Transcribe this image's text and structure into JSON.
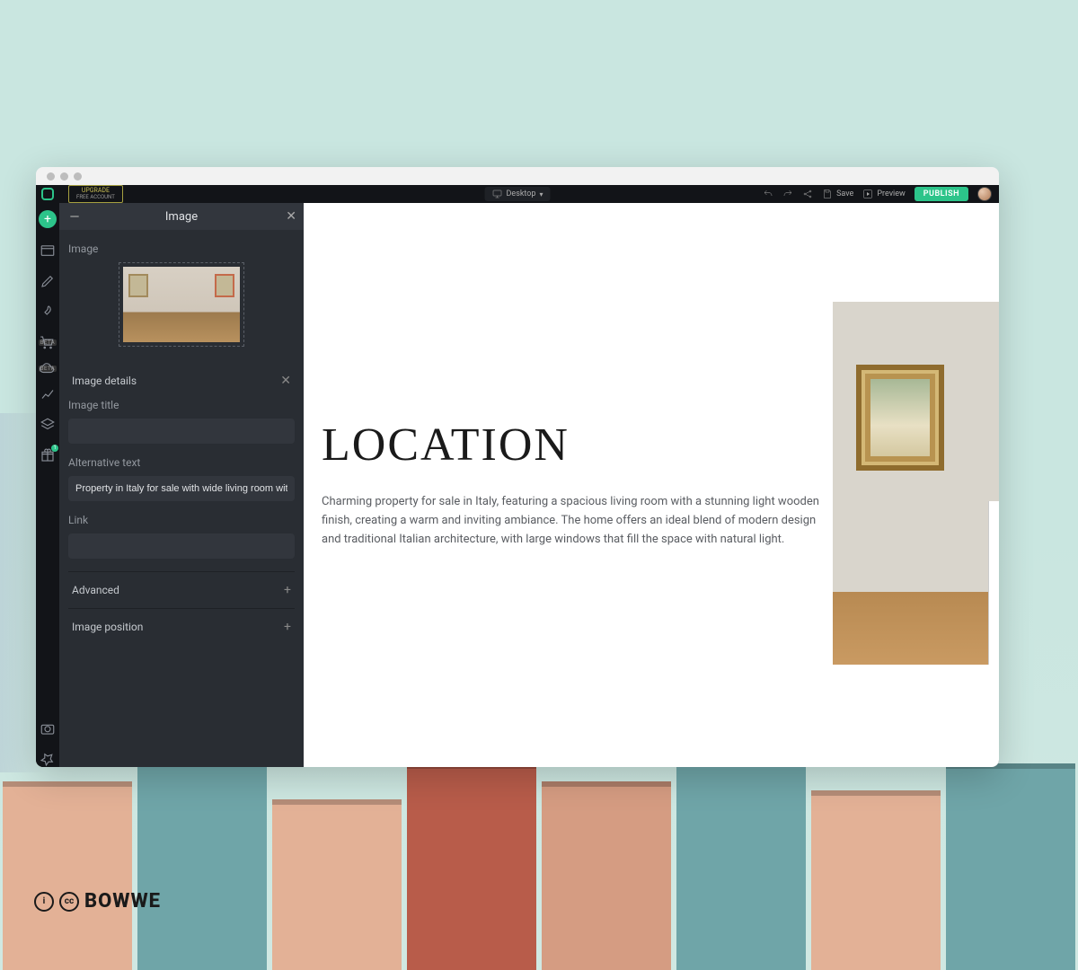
{
  "topbar": {
    "upgrade_label": "UPGRADE",
    "upgrade_sub": "FREE ACCOUNT",
    "view_mode": "Desktop",
    "save": "Save",
    "preview": "Preview",
    "publish": "PUBLISH"
  },
  "panel": {
    "title": "Image",
    "image_label": "Image",
    "details_label": "Image details",
    "title_label": "Image title",
    "title_value": "",
    "alt_label": "Alternative text",
    "alt_value": "Property in Italy for sale with wide living room with li",
    "link_label": "Link",
    "link_value": "",
    "advanced_label": "Advanced",
    "position_label": "Image position"
  },
  "canvas": {
    "heading": "LOCATION",
    "paragraph": "Charming property for sale in Italy, featuring a spacious living room with a stunning light wooden finish, creating a warm and inviting ambiance. The home offers an ideal blend of modern design and traditional Italian architecture, with large windows that fill the space with natural light."
  },
  "rail": {
    "beta": "BETA"
  },
  "watermark": {
    "brand": "BOWWE",
    "cc": "cc",
    "by": "i"
  }
}
